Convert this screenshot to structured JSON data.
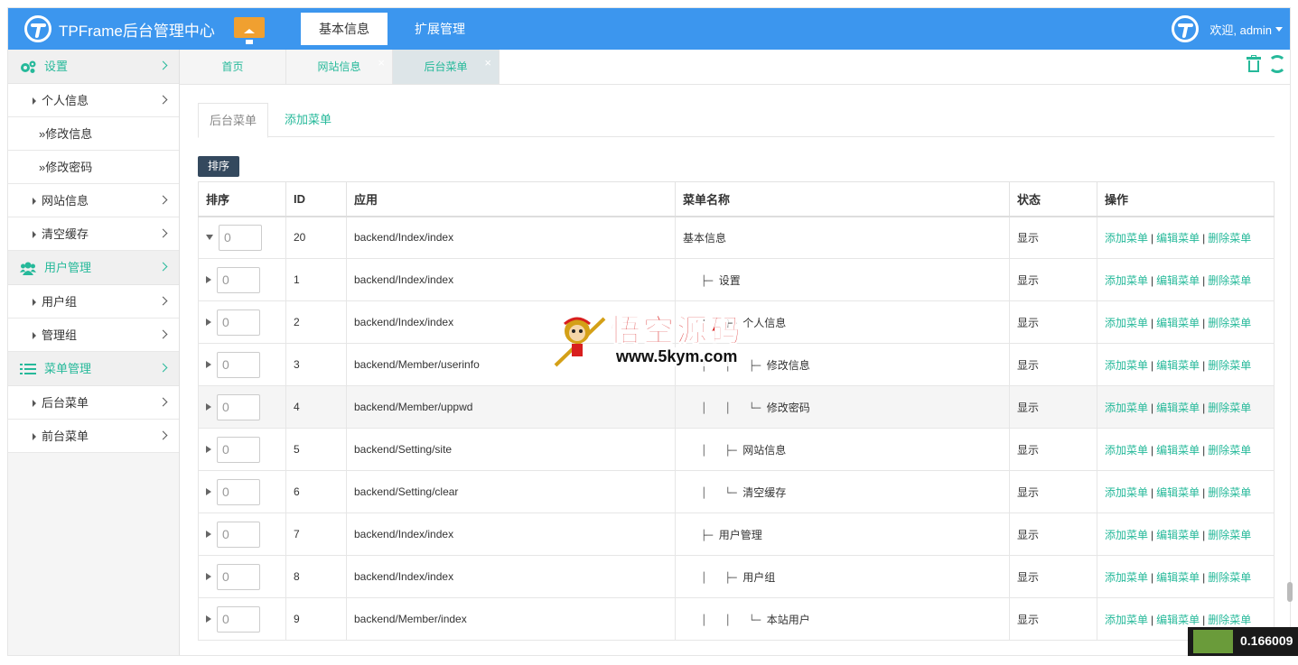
{
  "header": {
    "app_title": "TPFrame后台管理中心",
    "tabs": [
      {
        "label": "基本信息",
        "active": true
      },
      {
        "label": "扩展管理",
        "active": false
      }
    ],
    "user_greeting": "欢迎, admin"
  },
  "sidebar": {
    "groups": [
      {
        "label": "设置",
        "icon": "gears-icon",
        "items": [
          {
            "label": "个人信息",
            "children": [
              "修改信息",
              "修改密码"
            ]
          },
          {
            "label": "网站信息"
          },
          {
            "label": "清空缓存"
          }
        ]
      },
      {
        "label": "用户管理",
        "icon": "users-icon",
        "items": [
          {
            "label": "用户组"
          },
          {
            "label": "管理组"
          }
        ]
      },
      {
        "label": "菜单管理",
        "icon": "list-icon",
        "items": [
          {
            "label": "后台菜单"
          },
          {
            "label": "前台菜单"
          }
        ]
      }
    ],
    "sub_prefix": "»"
  },
  "page_tabs": [
    {
      "label": "首页",
      "closable": false
    },
    {
      "label": "网站信息",
      "closable": true
    },
    {
      "label": "后台菜单",
      "closable": true,
      "active": true
    }
  ],
  "content": {
    "tabs": [
      {
        "label": "后台菜单",
        "active": true
      },
      {
        "label": "添加菜单",
        "active": false
      }
    ],
    "sort_button": "排序",
    "table": {
      "headers": [
        "排序",
        "ID",
        "应用",
        "菜单名称",
        "状态",
        "操作"
      ],
      "rows": [
        {
          "expanded": true,
          "order": "0",
          "id": "20",
          "app": "backend/Index/index",
          "prefix": "",
          "name": "基本信息",
          "status": "显示"
        },
        {
          "expanded": false,
          "order": "0",
          "id": "1",
          "app": "backend/Index/index",
          "prefix": "   ├─ ",
          "name": "设置",
          "status": "显示"
        },
        {
          "expanded": false,
          "order": "0",
          "id": "2",
          "app": "backend/Index/index",
          "prefix": "   │   ├─ ",
          "name": "个人信息",
          "status": "显示"
        },
        {
          "expanded": false,
          "order": "0",
          "id": "3",
          "app": "backend/Member/userinfo",
          "prefix": "   │   │   ├─ ",
          "name": "修改信息",
          "status": "显示"
        },
        {
          "expanded": false,
          "order": "0",
          "id": "4",
          "app": "backend/Member/uppwd",
          "prefix": "   │   │   └─ ",
          "name": "修改密码",
          "status": "显示"
        },
        {
          "expanded": false,
          "order": "0",
          "id": "5",
          "app": "backend/Setting/site",
          "prefix": "   │   ├─ ",
          "name": "网站信息",
          "status": "显示"
        },
        {
          "expanded": false,
          "order": "0",
          "id": "6",
          "app": "backend/Setting/clear",
          "prefix": "   │   └─ ",
          "name": "清空缓存",
          "status": "显示"
        },
        {
          "expanded": false,
          "order": "0",
          "id": "7",
          "app": "backend/Index/index",
          "prefix": "   ├─ ",
          "name": "用户管理",
          "status": "显示"
        },
        {
          "expanded": false,
          "order": "0",
          "id": "8",
          "app": "backend/Index/index",
          "prefix": "   │   ├─ ",
          "name": "用户组",
          "status": "显示"
        },
        {
          "expanded": false,
          "order": "0",
          "id": "9",
          "app": "backend/Member/index",
          "prefix": "   │   │   └─ ",
          "name": "本站用户",
          "status": "显示"
        }
      ],
      "ops": [
        "添加菜单",
        "编辑菜单",
        "删除菜单"
      ],
      "op_separator": "|"
    }
  },
  "watermark": {
    "title": "悟空源码",
    "url": "www.5kym.com"
  },
  "perf_badge": "0.166009",
  "colors": {
    "header_bg": "#3c96ee",
    "accent": "#26b99a",
    "home_btn": "#f0a030",
    "sort_btn": "#34495e"
  }
}
